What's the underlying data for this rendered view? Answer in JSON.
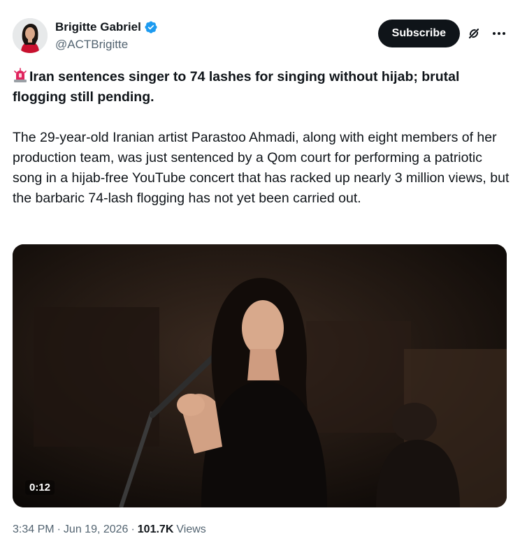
{
  "author": {
    "display_name": "Brigitte Gabriel",
    "handle": "@ACTBrigitte",
    "verified_icon": "verified-badge-icon",
    "verified_color": "#1d9bf0"
  },
  "actions": {
    "subscribe_label": "Subscribe",
    "grok_icon": "grok-icon",
    "more_icon": "more-options-icon"
  },
  "post": {
    "siren_icon": "police-light-emoji",
    "headline": "Iran sentences singer to 74 lashes for singing without hijab; brutal flogging still pending.",
    "body": "The 29-year-old Iranian artist Parastoo Ahmadi, along with eight members of her production team, was just sentenced by a Qom court for performing a patriotic song in a hijab-free YouTube concert that has racked up nearly 3 million views, but the barbaric 74-lash flogging has not yet been carried out."
  },
  "media": {
    "type": "video",
    "duration": "0:12"
  },
  "meta": {
    "time": "3:34 PM",
    "separator": "·",
    "date": "Jun 19, 2026",
    "views_count": "101.7K",
    "views_label": "Views"
  },
  "colors": {
    "text_primary": "#0f1419",
    "text_secondary": "#536471",
    "subscribe_bg": "#0f1419"
  }
}
